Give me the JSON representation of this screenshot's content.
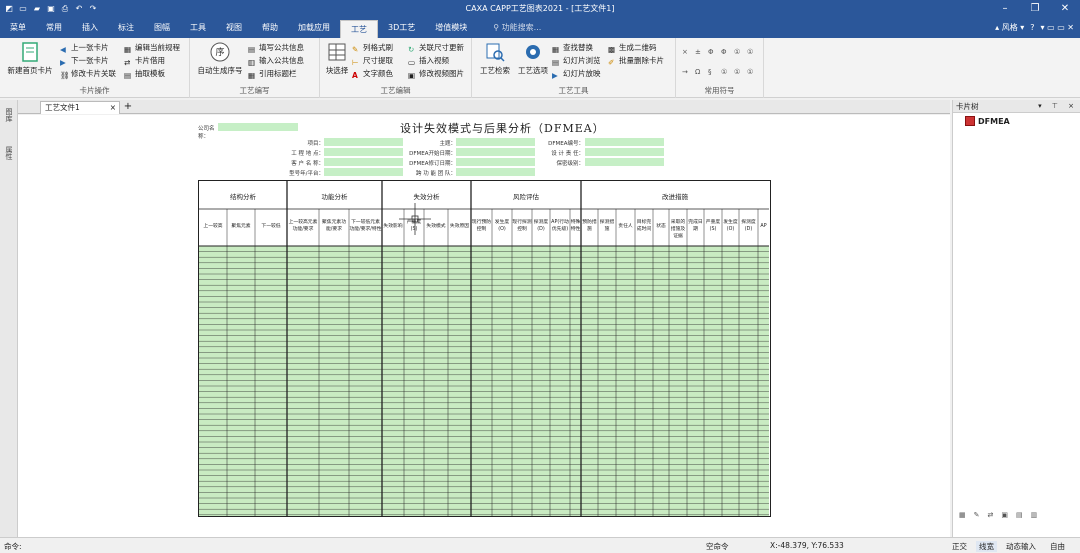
{
  "window": {
    "title": "CAXA CAPP工艺图表2021 - [工艺文件1]"
  },
  "menu": {
    "tabs": [
      "菜单",
      "常用",
      "插入",
      "标注",
      "图幅",
      "工具",
      "视图",
      "帮助",
      "加载应用",
      "工艺",
      "3D工艺",
      "增值模块"
    ],
    "active_tab": "工艺",
    "search_placeholder": "功能搜索...",
    "style_label": "风格",
    "help_icon": "?"
  },
  "ribbon": {
    "groups": {
      "card_ops": "卡片操作",
      "proc_write": "工艺编写",
      "proc_edit": "工艺编辑",
      "proc_tools": "工艺工具",
      "common_symbols": "常用符号"
    },
    "buttons": {
      "new_card": "新建首页卡片",
      "prev_card": "上一张卡片",
      "next_card": "下一张卡片",
      "modify_card_link": "修改卡片关联",
      "edit_current_rule": "编辑当前规程",
      "card_borrow": "卡片借用",
      "extract_template": "抽取模板",
      "auto_seq": "自动生成序号",
      "fill_public": "填写公共信息",
      "input_public": "输入公共信息",
      "ref_title": "引用标题栏",
      "block_select": "块选择",
      "format_brush": "列格式刷",
      "dim_extract": "尺寸提取",
      "text_color": "文字颜色",
      "link_dim_update": "关联尺寸更新",
      "insert_video": "插入视频",
      "modify_video_pic": "修改视频图片",
      "proc_retrieve": "工艺检索",
      "proc_options": "工艺选项",
      "find_replace": "查找替换",
      "slide_browse": "幻灯片浏览",
      "slide_play": "幻灯片放映",
      "gen_qr": "生成二维码",
      "batch_delete": "批量删除卡片"
    },
    "symbols": [
      "×",
      "±",
      "Φ",
      "Φ",
      "①",
      "①",
      "→",
      "Ω",
      "§",
      "①",
      "①",
      "①"
    ]
  },
  "document": {
    "tab_label": "工艺文件1",
    "form": {
      "title": "设计失效模式与后果分析（DFMEA）",
      "header_fields": {
        "company": "公司名称：",
        "project": "项目：",
        "factory": "工 程 地 点：",
        "customer": "客 户 名 称：",
        "model": "型号年/平台：",
        "subject": "主题：",
        "dfmea_start": "DFMEA开始日期：",
        "dfmea_revise": "DFMEA修订日期：",
        "cross_team": "跨 功 能 团 队：",
        "dfmea_id": "DFMEA编号：",
        "design_owner": "设 计 责 任：",
        "confidential": "保密级别："
      },
      "sections": [
        "结构分析",
        "功能分析",
        "失效分析",
        "风险评估",
        "改进措施"
      ],
      "columns": [
        "上一较高",
        "聚焦元素",
        "下一较低",
        "上一较高元素功能/要求",
        "聚焦元素功能/要求",
        "下一较低元素功能/要求/特性",
        "失效影响",
        "严重度(S)",
        "失效模式",
        "失效原因",
        "现行预防控制",
        "发生度(O)",
        "现行探测控制",
        "探测度(D)",
        "AP(行动优先级)",
        "特殊特性",
        "预防措施",
        "探测措施",
        "责任人",
        "目标完成时间",
        "状态",
        "采取的措施及证据",
        "完成日期",
        "严重度(S)",
        "发生度(O)",
        "探测度(D)",
        "AP"
      ],
      "crosshair_label": "严重度"
    }
  },
  "right_panel": {
    "title": "卡片树",
    "tree_root": "DFMEA"
  },
  "left_panel": {
    "tabs": [
      "图库",
      "属性"
    ]
  },
  "statusbar": {
    "command_label": "命令:",
    "empty_command": "空命令",
    "coords": "X:-48.379, Y:76.533",
    "modes": [
      "正交",
      "线宽",
      "动态输入",
      "自由"
    ]
  }
}
